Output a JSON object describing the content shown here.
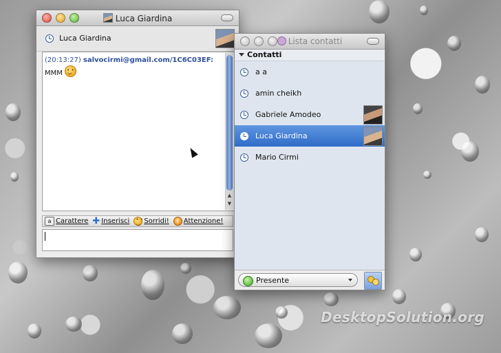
{
  "chat_window": {
    "title": "Luca Giardina",
    "contact_name": "Luca Giardina",
    "message": {
      "time": "(20:13:27)",
      "sender": "salvocirmi@gmail.com/1C6C03EF:",
      "text": "MMM"
    },
    "toolbar": {
      "font_label": "Carattere",
      "insert_label": "Inserisci",
      "smile_label": "Sorridi!",
      "attention_label": "Attenzione!"
    },
    "input_value": ""
  },
  "contacts_window": {
    "title": "Lista contatti",
    "group_label": "Contatti",
    "contacts": [
      {
        "name": "a a"
      },
      {
        "name": "amin cheikh"
      },
      {
        "name": "Gabriele Amodeo"
      },
      {
        "name": "Luca Giardina",
        "selected": true
      },
      {
        "name": "Mario Cirmi"
      }
    ],
    "status_label": "Presente"
  },
  "watermark": "DesktopSolution.org"
}
